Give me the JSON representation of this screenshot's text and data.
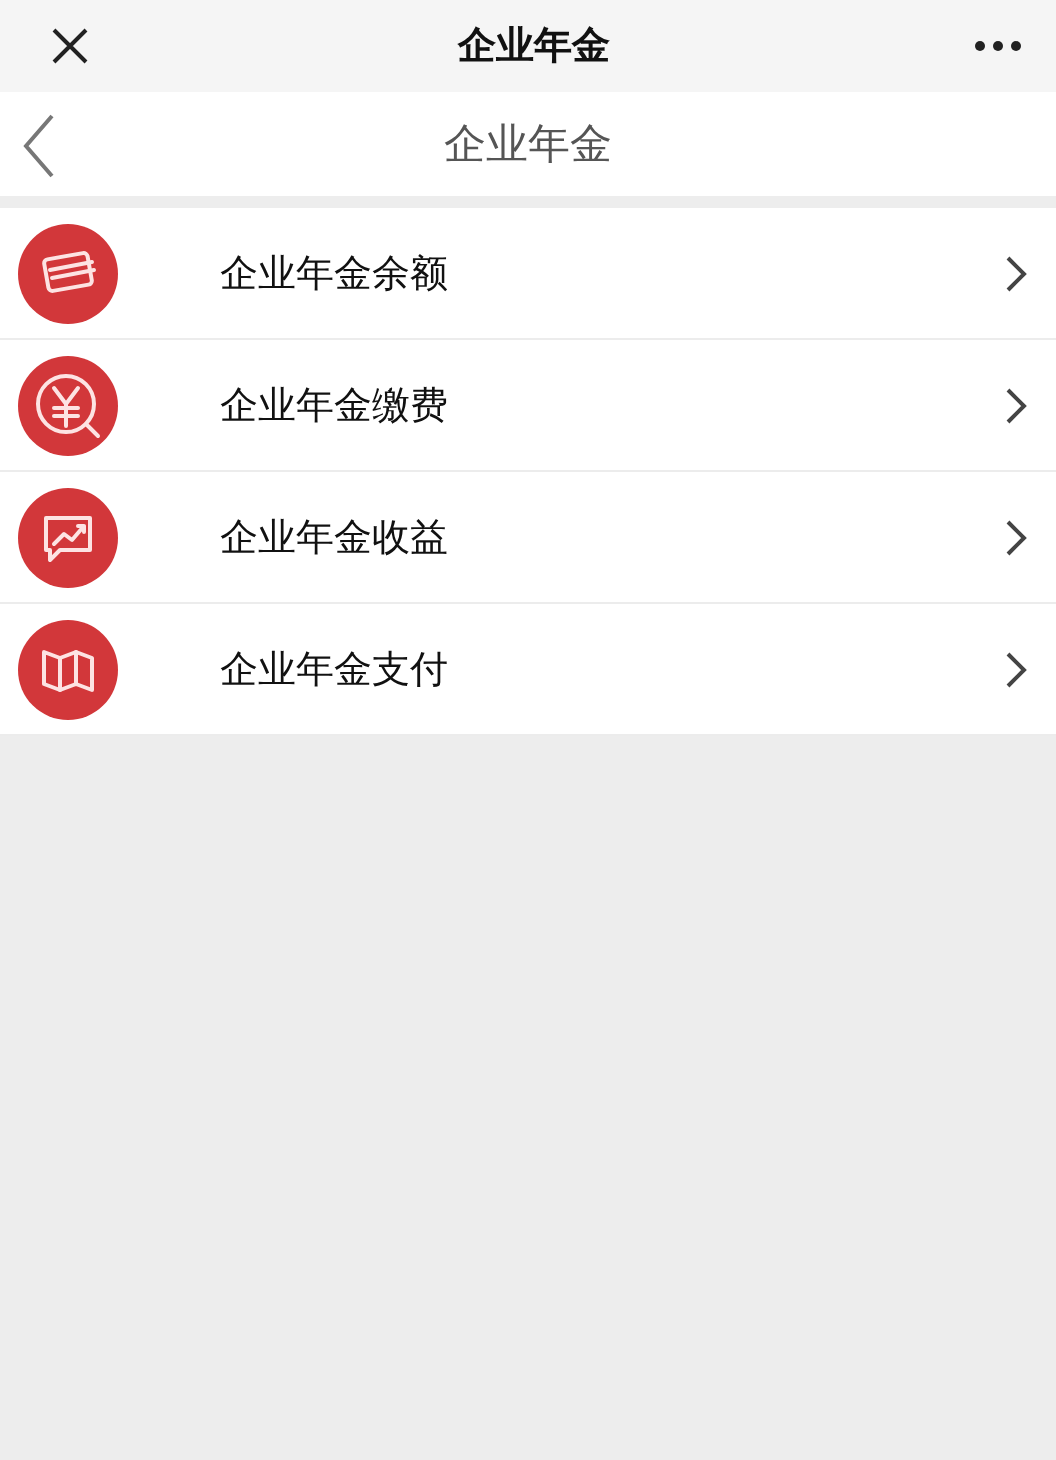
{
  "window": {
    "title": "企业年金"
  },
  "header": {
    "title": "企业年金"
  },
  "menu": [
    {
      "label": "企业年金余额",
      "kind": "card"
    },
    {
      "label": "企业年金缴费",
      "kind": "yen"
    },
    {
      "label": "企业年金收益",
      "kind": "chart"
    },
    {
      "label": "企业年金支付",
      "kind": "map"
    }
  ]
}
